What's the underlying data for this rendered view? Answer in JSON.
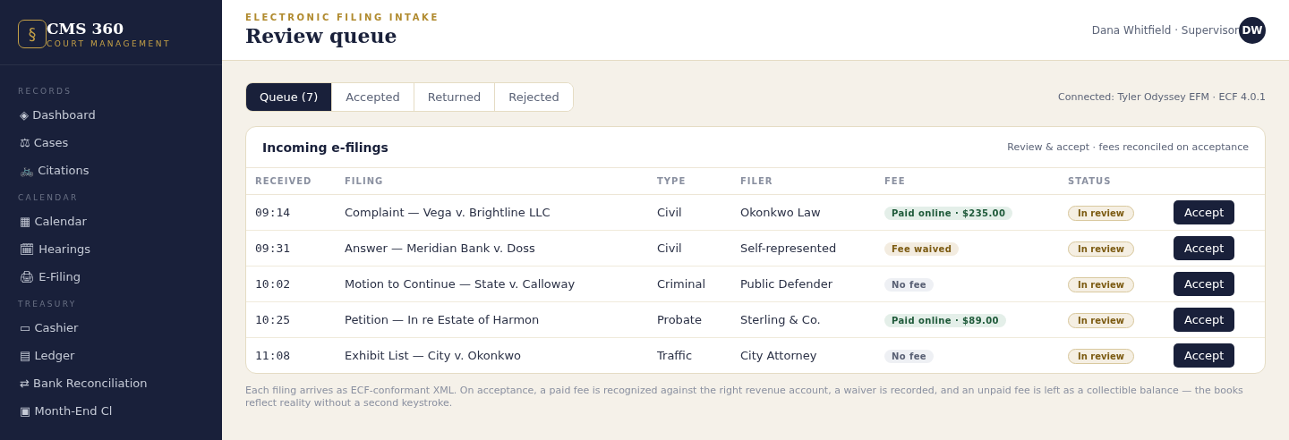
{
  "brand": {
    "mark": "§",
    "name": "CMS 360",
    "tagline": "COURT MANAGEMENT"
  },
  "sidebar": {
    "sections": [
      {
        "title": "RECORDS",
        "items": [
          {
            "icon": "◈",
            "label": "Dashboard",
            "selected": false
          },
          {
            "icon": "⚖",
            "label": "Cases",
            "selected": false
          },
          {
            "icon": "🚲",
            "label": "Citations",
            "selected": false
          }
        ]
      },
      {
        "title": "CALENDAR",
        "items": [
          {
            "icon": "▦",
            "label": "Calendar",
            "selected": false
          },
          {
            "icon": "🗓",
            "label": "Hearings",
            "selected": false
          },
          {
            "icon": "🖨",
            "label": "E-Filing",
            "selected": false
          }
        ]
      },
      {
        "title": "TREASURY",
        "items": [
          {
            "icon": "▭",
            "label": "Cashier",
            "selected": false
          },
          {
            "icon": "▤",
            "label": "Ledger",
            "selected": false
          },
          {
            "icon": "⇄",
            "label": "Bank Reconciliation",
            "selected": false
          },
          {
            "icon": "▣",
            "label": "Month-End Cl",
            "selected": false
          }
        ]
      }
    ]
  },
  "header": {
    "eyebrow": "ELECTRONIC FILING INTAKE",
    "title": "Review queue",
    "user": "Dana Whitfield · Supervisor",
    "avatar": "DW"
  },
  "tabs": [
    {
      "label": "Queue (7)",
      "selected": true
    },
    {
      "label": "Accepted",
      "selected": false
    },
    {
      "label": "Returned",
      "selected": false
    },
    {
      "label": "Rejected",
      "selected": false
    }
  ],
  "connection": "Connected: Tyler Odyssey EFM · ECF 4.0.1",
  "table": {
    "title": "Incoming e-filings",
    "subtitle": "Review & accept · fees reconciled on acceptance",
    "columns": [
      "RECEIVED",
      "FILING",
      "TYPE",
      "FILER",
      "FEE",
      "STATUS"
    ],
    "rows": [
      {
        "received": "09:14",
        "filing": "Complaint — Vega v. Brightline LLC",
        "type": "Civil",
        "filer": "Okonkwo Law",
        "fee": {
          "kind": "paid",
          "label": "Paid online · $235.00"
        },
        "status": {
          "kind": "review",
          "label": "In review"
        },
        "action": "Accept"
      },
      {
        "received": "09:31",
        "filing": "Answer — Meridian Bank v. Doss",
        "type": "Civil",
        "filer": "Self-represented",
        "fee": {
          "kind": "waived",
          "label": "Fee waived"
        },
        "status": {
          "kind": "review",
          "label": "In review"
        },
        "action": "Accept"
      },
      {
        "received": "10:02",
        "filing": "Motion to Continue — State v. Calloway",
        "type": "Criminal",
        "filer": "Public Defender",
        "fee": {
          "kind": "none",
          "label": "No fee"
        },
        "status": {
          "kind": "review",
          "label": "In review"
        },
        "action": "Accept"
      },
      {
        "received": "10:25",
        "filing": "Petition — In re Estate of Harmon",
        "type": "Probate",
        "filer": "Sterling & Co.",
        "fee": {
          "kind": "paid",
          "label": "Paid online · $89.00"
        },
        "status": {
          "kind": "review",
          "label": "In review"
        },
        "action": "Accept"
      },
      {
        "received": "11:08",
        "filing": "Exhibit List — City v. Okonkwo",
        "type": "Traffic",
        "filer": "City Attorney",
        "fee": {
          "kind": "none",
          "label": "No fee"
        },
        "status": {
          "kind": "review",
          "label": "In review"
        },
        "action": "Accept"
      }
    ]
  },
  "footnote": "Each filing arrives as ECF-conformant XML. On acceptance, a paid fee is recognized against the right revenue account, a waiver is recorded, and an unpaid fee is left as a collectible balance — the books reflect reality without a second keystroke."
}
